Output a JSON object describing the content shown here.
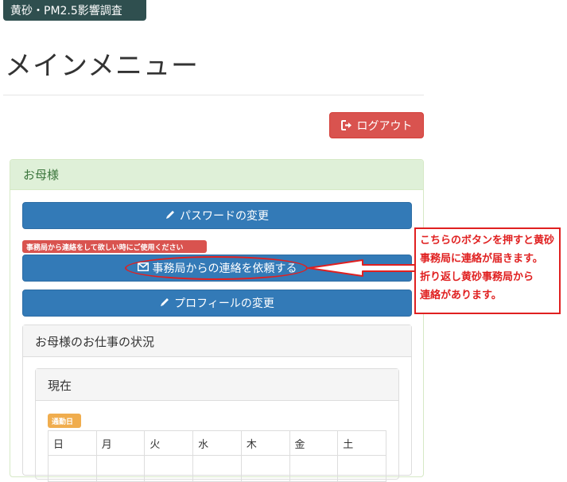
{
  "app": {
    "title": "黄砂・PM2.5影響調査"
  },
  "page": {
    "title": "メインメニュー"
  },
  "header": {
    "logout_label": "ログアウト"
  },
  "panel": {
    "heading": "お母様",
    "buttons": {
      "password_label": "パスワードの変更",
      "contact_note": "事務局から連絡をして欲しい時にご使用ください",
      "contact_label": "事務局からの連絡を依頼する",
      "profile_label": "プロフィールの変更"
    },
    "work_status": {
      "heading": "お母様のお仕事の状況",
      "current": {
        "heading": "現在",
        "workday_label": "通勤日",
        "weekdays": [
          "日",
          "月",
          "火",
          "水",
          "木",
          "金",
          "土"
        ]
      }
    }
  },
  "annotation": {
    "lines": [
      "こちらのボタンを押すと黄砂",
      "事務局に連絡が届きます。",
      "折り返し黄砂事務局から",
      "連絡があります。"
    ],
    "color": "#e02020"
  },
  "colors": {
    "brand": "#2f4f4f",
    "primary": "#337ab7",
    "danger": "#d9534f",
    "success_bg": "#dff0d8",
    "warning": "#f0ad4e"
  },
  "icons": {
    "logout": "sign-out-icon",
    "pencil": "pencil-icon",
    "envelope": "envelope-icon"
  }
}
